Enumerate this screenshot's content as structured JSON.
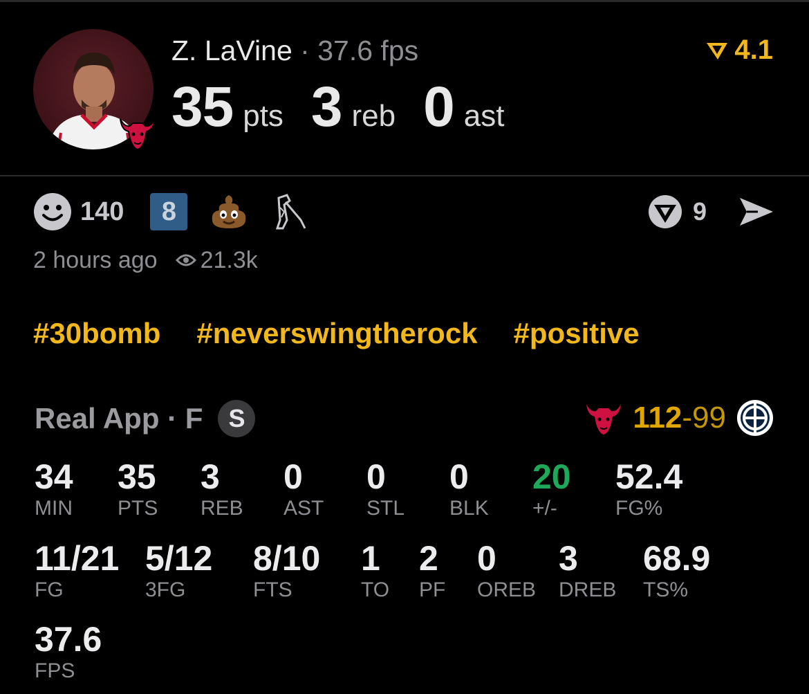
{
  "player": {
    "name": "Z. LaVine",
    "separator": "·",
    "fps": "37.6 fps",
    "pts_value": "35",
    "pts_unit": "pts",
    "reb_value": "3",
    "reb_unit": "reb",
    "ast_value": "0",
    "ast_unit": "ast"
  },
  "rating": {
    "value": "4.1",
    "icon": "real-rating-icon"
  },
  "reactions": {
    "smiley_count": "140",
    "badge_number": "8",
    "poop_icon": "poop-emoji",
    "statue_icon": "swinging-statue-emoji",
    "comment_count": "9"
  },
  "meta": {
    "time_ago": "2 hours ago",
    "views": "21.3k"
  },
  "tags": [
    "#30bomb",
    "#neverswingtherock",
    "#positive"
  ],
  "game": {
    "source": "Real App · F",
    "badge": "S",
    "home_score": "112",
    "dash": "-",
    "away_score": "99"
  },
  "stats_row1": [
    {
      "value": "34",
      "label": "MIN"
    },
    {
      "value": "35",
      "label": "PTS"
    },
    {
      "value": "3",
      "label": "REB"
    },
    {
      "value": "0",
      "label": "AST"
    },
    {
      "value": "0",
      "label": "STL"
    },
    {
      "value": "0",
      "label": "BLK"
    },
    {
      "value": "20",
      "label": "+/-"
    },
    {
      "value": "52.4",
      "label": "FG%"
    }
  ],
  "stats_row2": [
    {
      "value": "11/21",
      "label": "FG"
    },
    {
      "value": "5/12",
      "label": "3FG"
    },
    {
      "value": "8/10",
      "label": "FTS"
    },
    {
      "value": "1",
      "label": "TO"
    },
    {
      "value": "2",
      "label": "PF"
    },
    {
      "value": "0",
      "label": "OREB"
    },
    {
      "value": "3",
      "label": "DREB"
    },
    {
      "value": "68.9",
      "label": "TS%"
    }
  ],
  "stats_row3": [
    {
      "value": "37.6",
      "label": "FPS"
    }
  ],
  "colors": {
    "accent": "#f2b81b",
    "positive": "#1fa85a",
    "muted": "#8e8e93",
    "badge_blue": "#2f5d87"
  }
}
